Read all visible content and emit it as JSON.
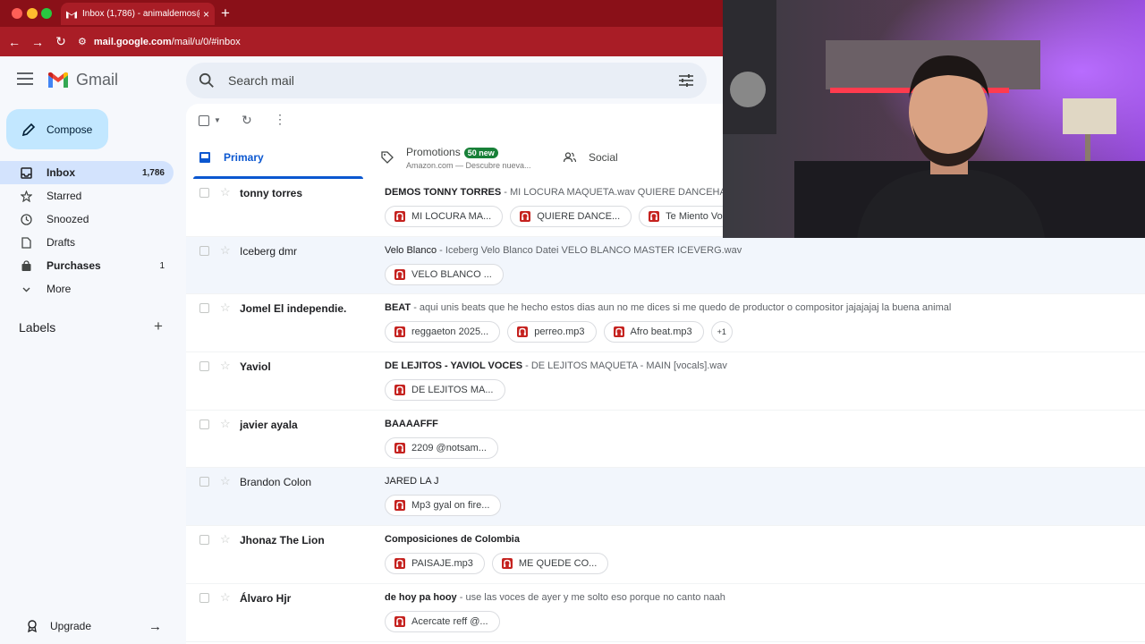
{
  "browser": {
    "tab_title": "Inbox (1,786) - animaldemos@",
    "url_host": "mail.google.com",
    "url_path": "/mail/u/0/#inbox",
    "new_tab": "+",
    "close_tab": "×"
  },
  "header": {
    "app_name": "Gmail",
    "search_placeholder": "Search mail"
  },
  "sidebar": {
    "compose": "Compose",
    "items": [
      {
        "label": "Inbox",
        "count": "1,786",
        "icon": "inbox-icon",
        "active": true
      },
      {
        "label": "Starred",
        "count": "",
        "icon": "star-icon"
      },
      {
        "label": "Snoozed",
        "count": "",
        "icon": "clock-icon"
      },
      {
        "label": "Drafts",
        "count": "",
        "icon": "file-icon"
      },
      {
        "label": "Purchases",
        "count": "1",
        "icon": "shopping-bag-icon"
      },
      {
        "label": "More",
        "count": "",
        "icon": "chevron-down-icon"
      }
    ],
    "labels_heading": "Labels",
    "upgrade": "Upgrade"
  },
  "tabs": {
    "primary": "Primary",
    "promotions": "Promotions",
    "promotions_badge": "50 new",
    "promotions_sub": "Amazon.com — Descubre nueva...",
    "social": "Social"
  },
  "emails": [
    {
      "sender": "tonny torres",
      "subject": "DEMOS TONNY TORRES",
      "snippet": " - MI LOCURA MAQUETA.wav QUIERE DANCEHA",
      "unread": true,
      "attachments": [
        "MI LOCURA MA...",
        "QUIERE DANCE...",
        "Te Miento Voce"
      ]
    },
    {
      "sender": "Iceberg dmr",
      "subject": "Velo Blanco",
      "snippet": " - Iceberg Velo Blanco Datei VELO BLANCO MASTER ICEVERG.wav",
      "unread": false,
      "attachments": [
        "VELO BLANCO ..."
      ]
    },
    {
      "sender": "Jomel El independie.",
      "subject": "BEAT",
      "snippet": " - aqui unis beats que he hecho estos dias aun no me dices si me quedo de productor o compositor jajajajaj la buena animal",
      "unread": true,
      "attachments": [
        "reggaeton 2025...",
        "perreo.mp3",
        "Afro beat.mp3"
      ],
      "more": "+1"
    },
    {
      "sender": "Yaviol",
      "subject": "DE LEJITOS - YAVIOL VOCES",
      "snippet": " - DE LEJITOS MAQUETA - MAIN [vocals].wav",
      "unread": true,
      "attachments": [
        "DE LEJITOS MA..."
      ]
    },
    {
      "sender": "javier ayala",
      "subject": "BAAAAFFF",
      "snippet": "",
      "unread": true,
      "attachments": [
        "2209 @notsam..."
      ]
    },
    {
      "sender": "Brandon Colon",
      "subject": "JARED LA J",
      "snippet": "",
      "unread": false,
      "attachments": [
        "Mp3 gyal on fire..."
      ]
    },
    {
      "sender": "Jhonaz The Lion",
      "subject": "Composiciones de Colombia",
      "snippet": "",
      "unread": true,
      "attachments": [
        "PAISAJE.mp3",
        "ME QUEDE CO..."
      ]
    },
    {
      "sender": "Álvaro Hjr",
      "subject": "de hoy pa hooy",
      "snippet": " - use las voces de ayer y me solto eso porque no canto naah",
      "unread": true,
      "attachments": [
        "Acercate reff @..."
      ]
    }
  ],
  "colors": {
    "browser_chrome": "#a91d26",
    "compose_bg": "#c2e7ff",
    "active_nav": "#d3e3fd",
    "primary_tab": "#0b57d0",
    "badge_green": "#188038",
    "attachment_red": "#c5221f"
  }
}
